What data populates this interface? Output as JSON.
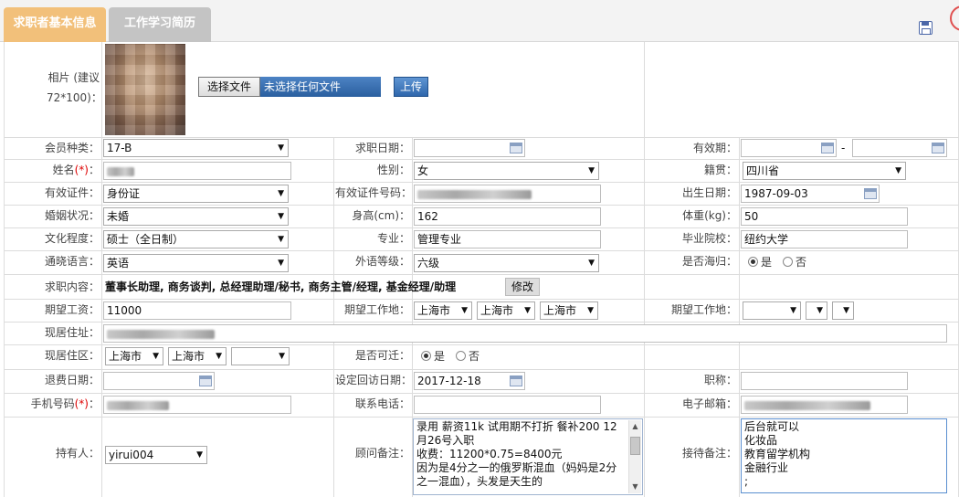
{
  "tabs": [
    {
      "label": "求职者基本信息"
    },
    {
      "label": "工作学习简历"
    }
  ],
  "photo": {
    "label": "相片 (建议72*100)：",
    "file_button": "选择文件",
    "file_status": "未选择任何文件",
    "upload_button": "上传"
  },
  "rows": {
    "member_type": {
      "label": "会员种类：",
      "value": "17-B"
    },
    "job_date": {
      "label": "求职日期：",
      "value": ""
    },
    "valid_period": {
      "label": "有效期：",
      "sep": "-"
    },
    "name": {
      "label": "姓名",
      "req": "(*)",
      "colon": "："
    },
    "gender": {
      "label": "性别：",
      "value": "女"
    },
    "origin": {
      "label": "籍贯：",
      "value": "四川省"
    },
    "id_type": {
      "label": "有效证件：",
      "value": "身份证"
    },
    "id_number": {
      "label": "有效证件号码："
    },
    "birth": {
      "label": "出生日期：",
      "value": "1987-09-03"
    },
    "marital": {
      "label": "婚姻状况：",
      "value": "未婚"
    },
    "height": {
      "label": "身高(cm)：",
      "value": "162"
    },
    "weight": {
      "label": "体重(kg)：",
      "value": "50"
    },
    "education": {
      "label": "文化程度：",
      "value": "硕士（全日制）"
    },
    "major": {
      "label": "专业：",
      "value": "管理专业"
    },
    "school": {
      "label": "毕业院校：",
      "value": "纽约大学"
    },
    "language": {
      "label": "通晓语言：",
      "value": "英语"
    },
    "lang_level": {
      "label": "外语等级：",
      "value": "六级"
    },
    "returnee": {
      "label": "是否海归：",
      "yes": "是",
      "no": "否"
    },
    "job_content": {
      "label": "求职内容：",
      "value": "董事长助理, 商务谈判, 总经理助理/秘书, 商务主管/经理, 基金经理/助理",
      "modify": "修改"
    },
    "salary": {
      "label": "期望工资：",
      "value": "11000"
    },
    "work_loc": {
      "label": "期望工作地：",
      "v1": "上海市",
      "v2": "上海市",
      "v3": "上海市"
    },
    "work_loc2": {
      "label": "期望工作地："
    },
    "address": {
      "label": "现居住址："
    },
    "district": {
      "label": "现居住区：",
      "v1": "上海市",
      "v2": "上海市"
    },
    "relocate": {
      "label": "是否可迁：",
      "yes": "是",
      "no": "否"
    },
    "refund_date": {
      "label": "退费日期："
    },
    "callback_date": {
      "label": "设定回访日期：",
      "value": "2017-12-18"
    },
    "title": {
      "label": "职称："
    },
    "mobile": {
      "label": "手机号码",
      "req": "(*)",
      "colon": "："
    },
    "phone": {
      "label": "联系电话："
    },
    "email": {
      "label": "电子邮箱："
    },
    "holder": {
      "label": "持有人：",
      "value": "yirui004"
    },
    "advisor_note": {
      "label": "顾问备注：",
      "text": "录用 薪资11k 试用期不打折 餐补200 12月26号入职\n收费：11200*0.75=8400元\n因为是4分之一的俄罗斯混血（妈妈是2分之一混血），头发是天生的"
    },
    "reception_note": {
      "label": "接待备注：",
      "text": "后台就可以\n化妆品\n教育留学机构\n金融行业\n;"
    }
  },
  "icons": {
    "save": "save-icon",
    "calendar": "calendar-icon",
    "dropdown": "chevron-down-icon"
  }
}
